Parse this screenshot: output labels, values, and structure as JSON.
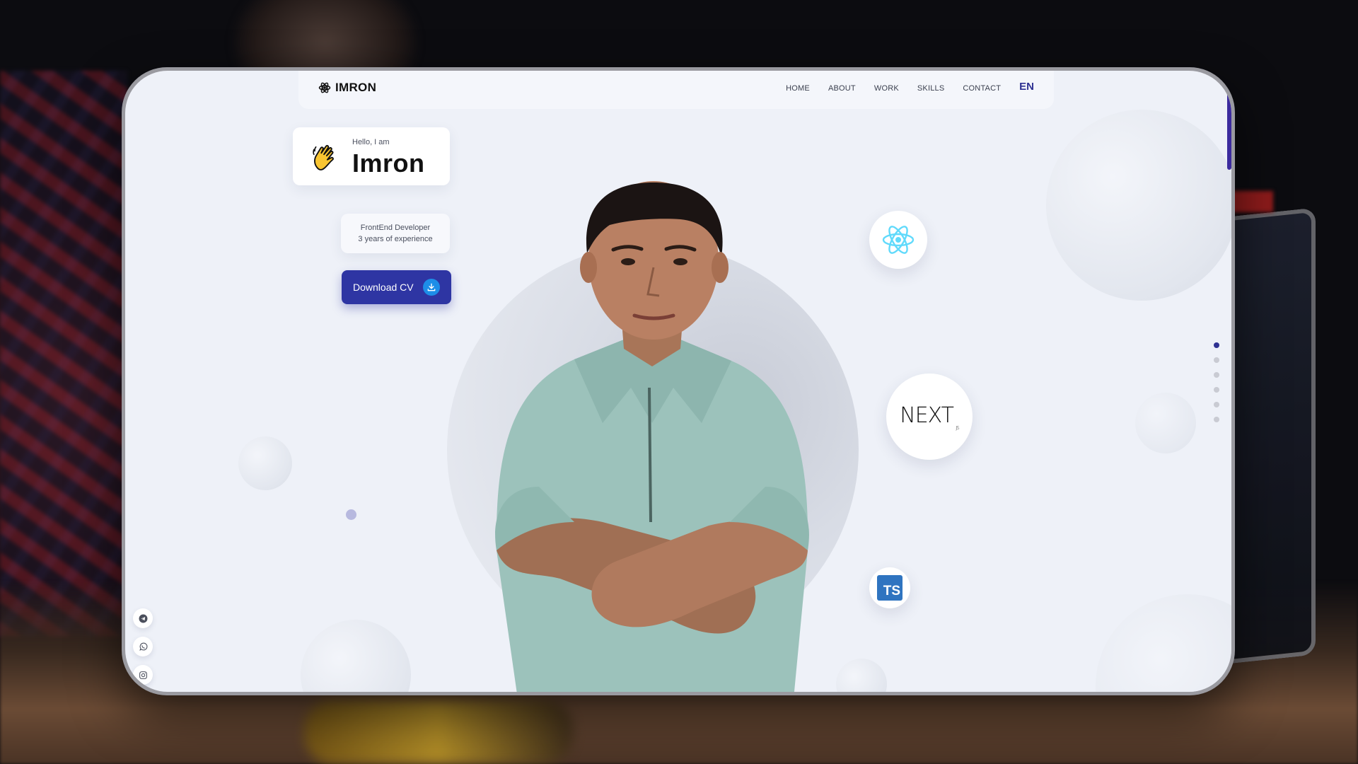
{
  "nav": {
    "logo": "IMRON",
    "links": [
      "HOME",
      "ABOUT",
      "WORK",
      "SKILLS",
      "CONTACT"
    ],
    "language": "EN"
  },
  "hero": {
    "greeting": "Hello, I am",
    "name": "Imron",
    "role": "FrontEnd Developer",
    "experience": "3 years of experience",
    "cv_button": "Download CV"
  },
  "tech": {
    "ts_label": "TS",
    "next_label": "NEXT",
    "next_suffix": ".JS"
  },
  "icons": {
    "logo": "atom-icon",
    "wave": "waving-hand-icon",
    "download": "download-icon",
    "react": "react-icon",
    "next": "nextjs-icon",
    "typescript": "typescript-icon",
    "socials": [
      "telegram-icon",
      "whatsapp-icon",
      "instagram-icon"
    ]
  },
  "section_dots": {
    "count": 6,
    "active_index": 0
  },
  "colors": {
    "accent": "#2e3192",
    "button": "#2e35a3",
    "download_icon_bg": "#1d8ee8",
    "screen_bg": "#eef1f8"
  }
}
